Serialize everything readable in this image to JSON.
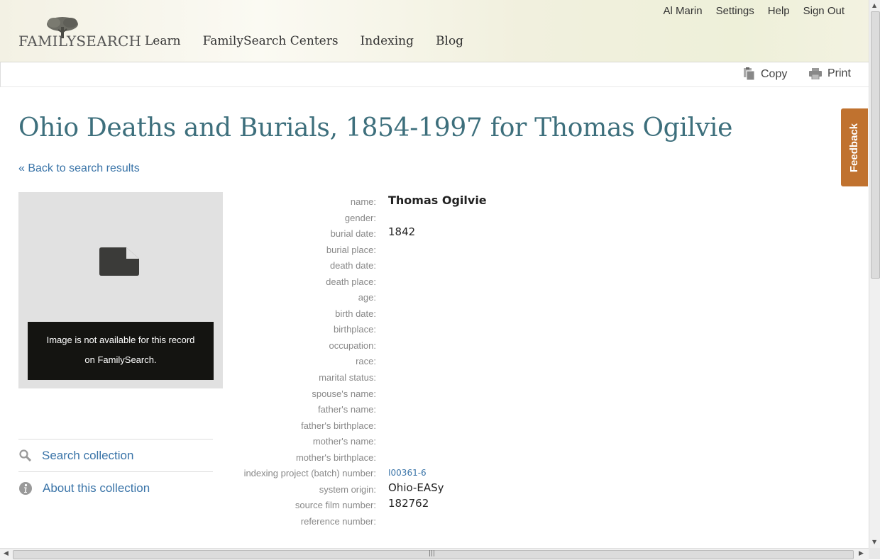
{
  "brand": {
    "logo_text": "FAMILYSEARCH",
    "accent": "#3d6f7c",
    "link_color": "#3a74a8",
    "feedback_color": "#c0722f"
  },
  "main_nav": [
    {
      "label": "Learn"
    },
    {
      "label": "FamilySearch Centers"
    },
    {
      "label": "Indexing"
    },
    {
      "label": "Blog"
    }
  ],
  "user_nav": [
    {
      "label": "Al Marin"
    },
    {
      "label": "Settings"
    },
    {
      "label": "Help"
    },
    {
      "label": "Sign Out"
    }
  ],
  "toolbar": {
    "copy_label": "Copy",
    "copy_icon": "copy-icon",
    "print_label": "Print",
    "print_icon": "printer-icon"
  },
  "page": {
    "title": "Ohio Deaths and Burials, 1854-1997 for Thomas Ogilvie",
    "back_link": "« Back to search results"
  },
  "image_panel": {
    "icon": "document-icon",
    "message_line1": "Image is not available for this record",
    "message_line2": "on FamilySearch."
  },
  "side_links": {
    "search_collection": "Search collection",
    "search_icon": "search-icon",
    "about_collection": "About this collection",
    "about_icon": "info-icon"
  },
  "record": [
    {
      "label": "name:",
      "value": "Thomas Ogilvie"
    },
    {
      "label": "gender:",
      "value": ""
    },
    {
      "label": "burial date:",
      "value": "1842"
    },
    {
      "label": "burial place:",
      "value": ""
    },
    {
      "label": "death date:",
      "value": ""
    },
    {
      "label": "death place:",
      "value": ""
    },
    {
      "label": "age:",
      "value": ""
    },
    {
      "label": "birth date:",
      "value": ""
    },
    {
      "label": "birthplace:",
      "value": ""
    },
    {
      "label": "occupation:",
      "value": ""
    },
    {
      "label": "race:",
      "value": ""
    },
    {
      "label": "marital status:",
      "value": ""
    },
    {
      "label": "spouse's name:",
      "value": ""
    },
    {
      "label": "father's name:",
      "value": ""
    },
    {
      "label": "father's birthplace:",
      "value": ""
    },
    {
      "label": "mother's name:",
      "value": ""
    },
    {
      "label": "mother's birthplace:",
      "value": ""
    },
    {
      "label": "indexing project (batch) number:",
      "value": "I00361-6"
    },
    {
      "label": "system origin:",
      "value": "Ohio-EASy"
    },
    {
      "label": "source film number:",
      "value": "182762"
    },
    {
      "label": "reference number:",
      "value": ""
    }
  ],
  "feedback": {
    "label": "Feedback"
  }
}
